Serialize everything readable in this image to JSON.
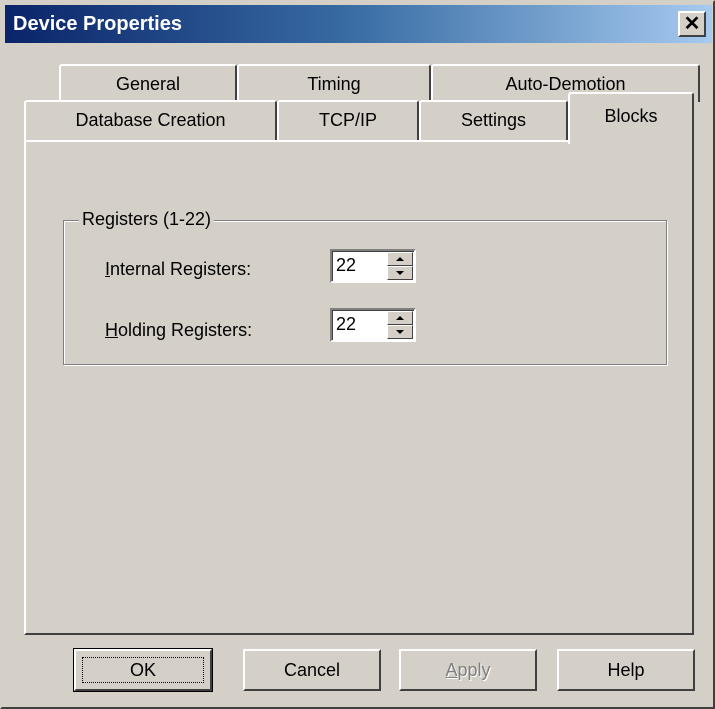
{
  "window": {
    "title": "Device Properties",
    "close_glyph": "✕"
  },
  "tabs": {
    "row_back": [
      {
        "label": "General"
      },
      {
        "label": "Timing"
      },
      {
        "label": "Auto-Demotion"
      }
    ],
    "row_front": [
      {
        "label": "Database Creation"
      },
      {
        "label": "TCP/IP"
      },
      {
        "label": "Settings"
      },
      {
        "label": "Blocks",
        "selected": true
      }
    ]
  },
  "registers": {
    "group_label": "Registers (1-22)",
    "internal": {
      "label_accel": "I",
      "label_rest": "nternal Registers:",
      "value": "22"
    },
    "holding": {
      "label_accel": "H",
      "label_rest": "olding Registers:",
      "value": "22"
    }
  },
  "buttons": {
    "ok": "OK",
    "cancel": "Cancel",
    "apply_accel": "A",
    "apply_rest": "pply",
    "help": "Help"
  },
  "icons": {
    "close": "close-icon",
    "spin_up": "arrow-up-icon",
    "spin_down": "arrow-down-icon"
  },
  "colors": {
    "title_start": "#0a246a",
    "title_end": "#a6caf0",
    "face": "#d4d0c8"
  }
}
